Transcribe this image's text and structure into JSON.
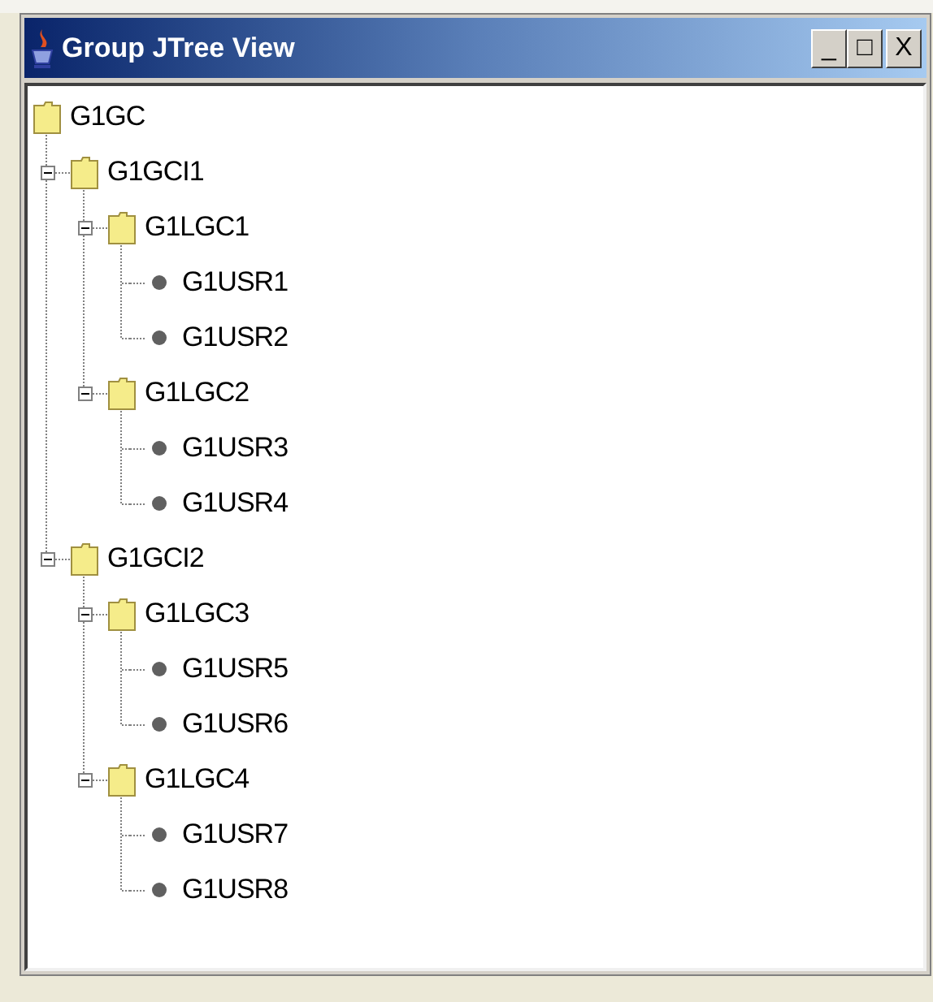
{
  "window": {
    "title": "Group JTree View",
    "buttons": [
      "_",
      "□",
      "X"
    ]
  },
  "tree": [
    {
      "label": "G1GC",
      "kind": "folder",
      "expanded": true,
      "children": [
        {
          "label": "G1GCI1",
          "kind": "folder",
          "expanded": true,
          "children": [
            {
              "label": "G1LGC1",
              "kind": "folder",
              "expanded": true,
              "children": [
                {
                  "label": "G1USR1",
                  "kind": "leaf"
                },
                {
                  "label": "G1USR2",
                  "kind": "leaf"
                }
              ]
            },
            {
              "label": "G1LGC2",
              "kind": "folder",
              "expanded": true,
              "children": [
                {
                  "label": "G1USR3",
                  "kind": "leaf"
                },
                {
                  "label": "G1USR4",
                  "kind": "leaf"
                }
              ]
            }
          ]
        },
        {
          "label": "G1GCI2",
          "kind": "folder",
          "expanded": true,
          "children": [
            {
              "label": "G1LGC3",
              "kind": "folder",
              "expanded": true,
              "children": [
                {
                  "label": "G1USR5",
                  "kind": "leaf"
                },
                {
                  "label": "G1USR6",
                  "kind": "leaf"
                }
              ]
            },
            {
              "label": "G1LGC4",
              "kind": "folder",
              "expanded": true,
              "children": [
                {
                  "label": "G1USR7",
                  "kind": "leaf"
                },
                {
                  "label": "G1USR8",
                  "kind": "leaf"
                }
              ]
            }
          ]
        }
      ]
    }
  ]
}
